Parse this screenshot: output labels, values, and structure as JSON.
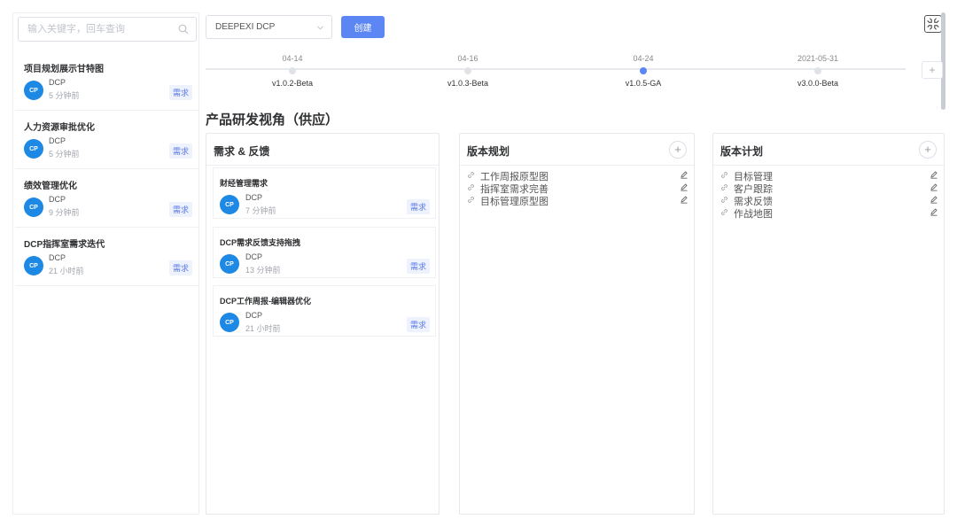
{
  "search": {
    "placeholder": "输入关键字，回车查询"
  },
  "left_items": [
    {
      "title": "项目规划展示甘特图",
      "avatar": "CP",
      "user": "DCP",
      "time": "5 分钟前",
      "tag": "需求"
    },
    {
      "title": "人力资源审批优化",
      "avatar": "CP",
      "user": "DCP",
      "time": "5 分钟前",
      "tag": "需求"
    },
    {
      "title": "绩效管理优化",
      "avatar": "CP",
      "user": "DCP",
      "time": "9 分钟前",
      "tag": "需求"
    },
    {
      "title": "DCP指挥室需求迭代",
      "avatar": "CP",
      "user": "DCP",
      "time": "21 小时前",
      "tag": "需求"
    }
  ],
  "toolbar": {
    "select_value": "DEEPEXI DCP",
    "create_label": "创建",
    "add_label": "+"
  },
  "timeline": [
    {
      "date": "04-14",
      "version": "v1.0.2-Beta",
      "active": false
    },
    {
      "date": "04-16",
      "version": "v1.0.3-Beta",
      "active": false
    },
    {
      "date": "04-24",
      "version": "v1.0.5-GA",
      "active": true
    },
    {
      "date": "2021-05-31",
      "version": "v3.0.0-Beta",
      "active": false
    }
  ],
  "section_title": "产品研发视角（供应）",
  "columns": {
    "feedback": {
      "title": "需求 & 反馈",
      "cards": [
        {
          "title": "财经管理需求",
          "avatar": "CP",
          "user": "DCP",
          "time": "7 分钟前",
          "tag": "需求"
        },
        {
          "title": "DCP需求反馈支持拖拽",
          "avatar": "CP",
          "user": "DCP",
          "time": "13 分钟前",
          "tag": "需求"
        },
        {
          "title": "DCP工作周报-编辑器优化",
          "avatar": "CP",
          "user": "DCP",
          "time": "21 小时前",
          "tag": "需求"
        }
      ]
    },
    "planning": {
      "title": "版本规划",
      "add_label": "+",
      "links": [
        "工作周报原型图",
        "指挥室需求完善",
        "目标管理原型图"
      ]
    },
    "plan": {
      "title": "版本计划",
      "add_label": "+",
      "links": [
        "目标管理",
        "客户跟踪",
        "需求反馈",
        "作战地图"
      ]
    }
  },
  "colors": {
    "accent": "#5d86f5",
    "avatar": "#1e88e5",
    "tag_text": "#5b7be8",
    "tag_bg": "#eef2fd"
  },
  "icons": {
    "search": "search-icon",
    "chevron": "chevron-down-icon",
    "collapse": "collapse-icon",
    "link": "link-icon",
    "edit": "edit-icon"
  }
}
